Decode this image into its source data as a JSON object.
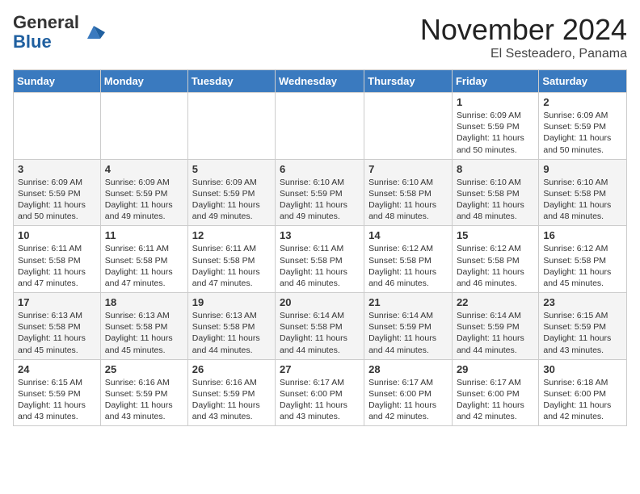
{
  "logo": {
    "general": "General",
    "blue": "Blue"
  },
  "title": "November 2024",
  "location": "El Sesteadero, Panama",
  "days_of_week": [
    "Sunday",
    "Monday",
    "Tuesday",
    "Wednesday",
    "Thursday",
    "Friday",
    "Saturday"
  ],
  "weeks": [
    [
      {
        "day": "",
        "info": ""
      },
      {
        "day": "",
        "info": ""
      },
      {
        "day": "",
        "info": ""
      },
      {
        "day": "",
        "info": ""
      },
      {
        "day": "",
        "info": ""
      },
      {
        "day": "1",
        "info": "Sunrise: 6:09 AM\nSunset: 5:59 PM\nDaylight: 11 hours and 50 minutes."
      },
      {
        "day": "2",
        "info": "Sunrise: 6:09 AM\nSunset: 5:59 PM\nDaylight: 11 hours and 50 minutes."
      }
    ],
    [
      {
        "day": "3",
        "info": "Sunrise: 6:09 AM\nSunset: 5:59 PM\nDaylight: 11 hours and 50 minutes."
      },
      {
        "day": "4",
        "info": "Sunrise: 6:09 AM\nSunset: 5:59 PM\nDaylight: 11 hours and 49 minutes."
      },
      {
        "day": "5",
        "info": "Sunrise: 6:09 AM\nSunset: 5:59 PM\nDaylight: 11 hours and 49 minutes."
      },
      {
        "day": "6",
        "info": "Sunrise: 6:10 AM\nSunset: 5:59 PM\nDaylight: 11 hours and 49 minutes."
      },
      {
        "day": "7",
        "info": "Sunrise: 6:10 AM\nSunset: 5:58 PM\nDaylight: 11 hours and 48 minutes."
      },
      {
        "day": "8",
        "info": "Sunrise: 6:10 AM\nSunset: 5:58 PM\nDaylight: 11 hours and 48 minutes."
      },
      {
        "day": "9",
        "info": "Sunrise: 6:10 AM\nSunset: 5:58 PM\nDaylight: 11 hours and 48 minutes."
      }
    ],
    [
      {
        "day": "10",
        "info": "Sunrise: 6:11 AM\nSunset: 5:58 PM\nDaylight: 11 hours and 47 minutes."
      },
      {
        "day": "11",
        "info": "Sunrise: 6:11 AM\nSunset: 5:58 PM\nDaylight: 11 hours and 47 minutes."
      },
      {
        "day": "12",
        "info": "Sunrise: 6:11 AM\nSunset: 5:58 PM\nDaylight: 11 hours and 47 minutes."
      },
      {
        "day": "13",
        "info": "Sunrise: 6:11 AM\nSunset: 5:58 PM\nDaylight: 11 hours and 46 minutes."
      },
      {
        "day": "14",
        "info": "Sunrise: 6:12 AM\nSunset: 5:58 PM\nDaylight: 11 hours and 46 minutes."
      },
      {
        "day": "15",
        "info": "Sunrise: 6:12 AM\nSunset: 5:58 PM\nDaylight: 11 hours and 46 minutes."
      },
      {
        "day": "16",
        "info": "Sunrise: 6:12 AM\nSunset: 5:58 PM\nDaylight: 11 hours and 45 minutes."
      }
    ],
    [
      {
        "day": "17",
        "info": "Sunrise: 6:13 AM\nSunset: 5:58 PM\nDaylight: 11 hours and 45 minutes."
      },
      {
        "day": "18",
        "info": "Sunrise: 6:13 AM\nSunset: 5:58 PM\nDaylight: 11 hours and 45 minutes."
      },
      {
        "day": "19",
        "info": "Sunrise: 6:13 AM\nSunset: 5:58 PM\nDaylight: 11 hours and 44 minutes."
      },
      {
        "day": "20",
        "info": "Sunrise: 6:14 AM\nSunset: 5:58 PM\nDaylight: 11 hours and 44 minutes."
      },
      {
        "day": "21",
        "info": "Sunrise: 6:14 AM\nSunset: 5:59 PM\nDaylight: 11 hours and 44 minutes."
      },
      {
        "day": "22",
        "info": "Sunrise: 6:14 AM\nSunset: 5:59 PM\nDaylight: 11 hours and 44 minutes."
      },
      {
        "day": "23",
        "info": "Sunrise: 6:15 AM\nSunset: 5:59 PM\nDaylight: 11 hours and 43 minutes."
      }
    ],
    [
      {
        "day": "24",
        "info": "Sunrise: 6:15 AM\nSunset: 5:59 PM\nDaylight: 11 hours and 43 minutes."
      },
      {
        "day": "25",
        "info": "Sunrise: 6:16 AM\nSunset: 5:59 PM\nDaylight: 11 hours and 43 minutes."
      },
      {
        "day": "26",
        "info": "Sunrise: 6:16 AM\nSunset: 5:59 PM\nDaylight: 11 hours and 43 minutes."
      },
      {
        "day": "27",
        "info": "Sunrise: 6:17 AM\nSunset: 6:00 PM\nDaylight: 11 hours and 43 minutes."
      },
      {
        "day": "28",
        "info": "Sunrise: 6:17 AM\nSunset: 6:00 PM\nDaylight: 11 hours and 42 minutes."
      },
      {
        "day": "29",
        "info": "Sunrise: 6:17 AM\nSunset: 6:00 PM\nDaylight: 11 hours and 42 minutes."
      },
      {
        "day": "30",
        "info": "Sunrise: 6:18 AM\nSunset: 6:00 PM\nDaylight: 11 hours and 42 minutes."
      }
    ]
  ]
}
